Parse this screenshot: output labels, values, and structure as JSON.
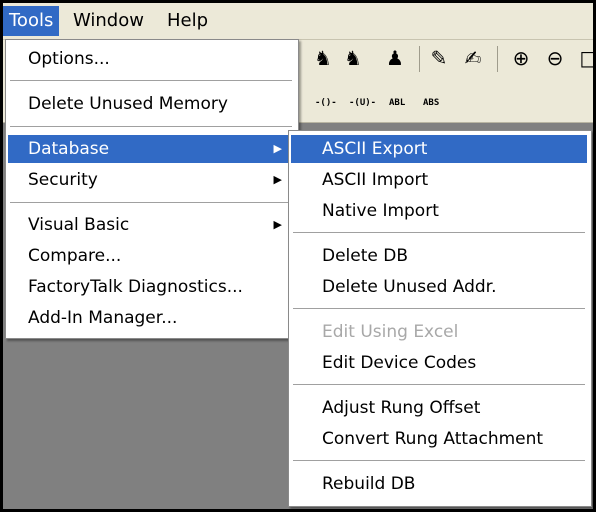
{
  "menubar": {
    "items": [
      {
        "label": "Tools"
      },
      {
        "label": "Window"
      },
      {
        "label": "Help"
      }
    ]
  },
  "toolbar": {
    "instructions": [
      "-()-",
      "-(U)-",
      "ABL",
      "ABS"
    ]
  },
  "tools_menu": {
    "items": [
      {
        "label": "Options..."
      },
      {
        "label": "Delete Unused Memory"
      },
      {
        "label": "Database"
      },
      {
        "label": "Security"
      },
      {
        "label": "Visual Basic"
      },
      {
        "label": "Compare..."
      },
      {
        "label": "FactoryTalk Diagnostics..."
      },
      {
        "label": "Add-In Manager..."
      }
    ]
  },
  "database_menu": {
    "items": [
      {
        "label": "ASCII Export"
      },
      {
        "label": "ASCII Import"
      },
      {
        "label": "Native Import"
      },
      {
        "label": "Delete DB"
      },
      {
        "label": "Delete Unused Addr."
      },
      {
        "label": "Edit Using Excel"
      },
      {
        "label": "Edit Device Codes"
      },
      {
        "label": "Adjust Rung Offset"
      },
      {
        "label": "Convert Rung Attachment"
      },
      {
        "label": "Rebuild DB"
      }
    ]
  },
  "colors": {
    "highlight": "#316ac5",
    "menubar": "#ece9d8",
    "workspace": "#808080",
    "disabled_text": "#a8a8a8"
  }
}
